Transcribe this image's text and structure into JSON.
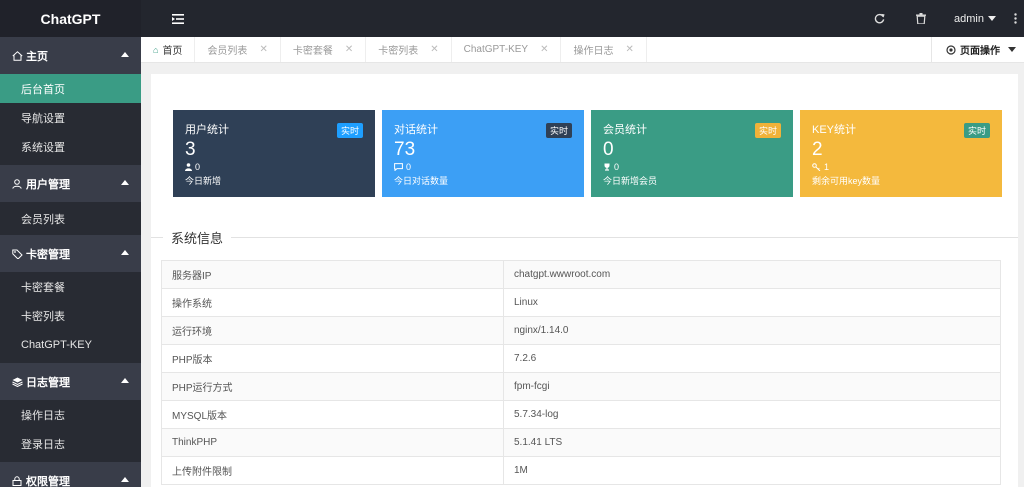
{
  "app": {
    "title": "ChatGPT"
  },
  "topbar": {
    "user": "admin"
  },
  "sidebar": {
    "groups": [
      {
        "label": "主页",
        "icon": "home-icon",
        "items": [
          "后台首页",
          "导航设置",
          "系统设置"
        ]
      },
      {
        "label": "用户管理",
        "icon": "user-icon",
        "items": [
          "会员列表"
        ]
      },
      {
        "label": "卡密管理",
        "icon": "tag-icon",
        "items": [
          "卡密套餐",
          "卡密列表",
          "ChatGPT-KEY"
        ]
      },
      {
        "label": "日志管理",
        "icon": "layers-icon",
        "items": [
          "操作日志",
          "登录日志"
        ]
      },
      {
        "label": "权限管理",
        "icon": "lock-icon",
        "items": []
      }
    ],
    "active_item": "后台首页"
  },
  "tabs": {
    "items": [
      "首页",
      "会员列表",
      "卡密套餐",
      "卡密列表",
      "ChatGPT-KEY",
      "操作日志"
    ],
    "page_ops": "页面操作"
  },
  "cards": [
    {
      "title": "用户统计",
      "badge": "实时",
      "value": "3",
      "sub": "0",
      "note": "今日新增",
      "color": "#2f4056",
      "badge_color": "#1e9fff",
      "icon": "user-icon"
    },
    {
      "title": "对话统计",
      "badge": "实时",
      "value": "73",
      "sub": "0",
      "note": "今日对话数量",
      "color": "#3c9ff5",
      "badge_color": "#2f4056",
      "icon": "chat-icon"
    },
    {
      "title": "会员统计",
      "badge": "实时",
      "value": "0",
      "sub": "0",
      "note": "今日新增会员",
      "color": "#3a9c85",
      "badge_color": "#f0b239",
      "icon": "trophy-icon"
    },
    {
      "title": "KEY统计",
      "badge": "实时",
      "value": "2",
      "sub": "1",
      "note": "剩余可用key数量",
      "color": "#f4b93d",
      "badge_color": "#3a9c85",
      "icon": "key-icon"
    }
  ],
  "system": {
    "title": "系统信息",
    "rows": [
      [
        "服务器IP",
        "chatgpt.wwwroot.com"
      ],
      [
        "操作系统",
        "Linux"
      ],
      [
        "运行环境",
        "nginx/1.14.0"
      ],
      [
        "PHP版本",
        "7.2.6"
      ],
      [
        "PHP运行方式",
        "fpm-fcgi"
      ],
      [
        "MYSQL版本",
        "5.7.34-log"
      ],
      [
        "ThinkPHP",
        "5.1.41 LTS"
      ],
      [
        "上传附件限制",
        "1M"
      ]
    ]
  }
}
